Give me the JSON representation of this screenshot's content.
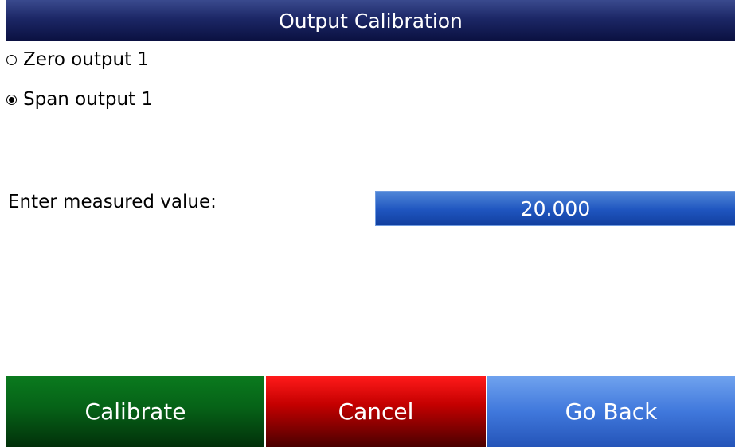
{
  "title": "Output Calibration",
  "options": [
    {
      "label": "Zero output 1",
      "selected": false
    },
    {
      "label": "Span output 1",
      "selected": true
    }
  ],
  "measured": {
    "label": "Enter measured value:",
    "value": "20.000"
  },
  "buttons": {
    "calibrate": "Calibrate",
    "cancel": "Cancel",
    "go_back": "Go Back"
  },
  "colors": {
    "title_bar": "#1c2766",
    "value_field": "#1f55bf",
    "calibrate": "#066217",
    "cancel": "#c40000",
    "go_back": "#4078dc"
  }
}
